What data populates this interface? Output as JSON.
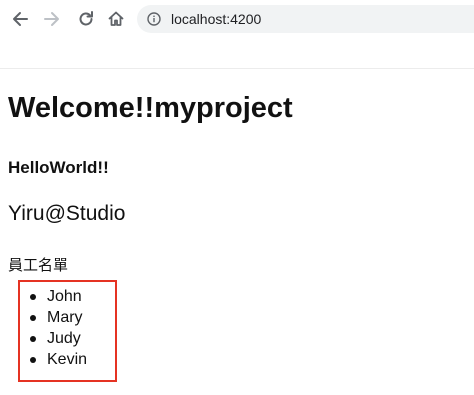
{
  "browser": {
    "address": "localhost:4200",
    "icons": {
      "back": "back-arrow-icon",
      "forward": "forward-arrow-icon",
      "reload": "reload-icon",
      "home": "home-icon",
      "site_info": "info-icon"
    }
  },
  "page": {
    "title": "Welcome!!myproject",
    "subtitle": "HelloWorld!!",
    "studio": "Yiru@Studio",
    "list_caption": "員工名單",
    "employees": [
      "John",
      "Mary",
      "Judy",
      "Kevin"
    ]
  },
  "colors": {
    "highlight_border": "#e53323",
    "omnibox_bg": "#f1f3f4"
  }
}
